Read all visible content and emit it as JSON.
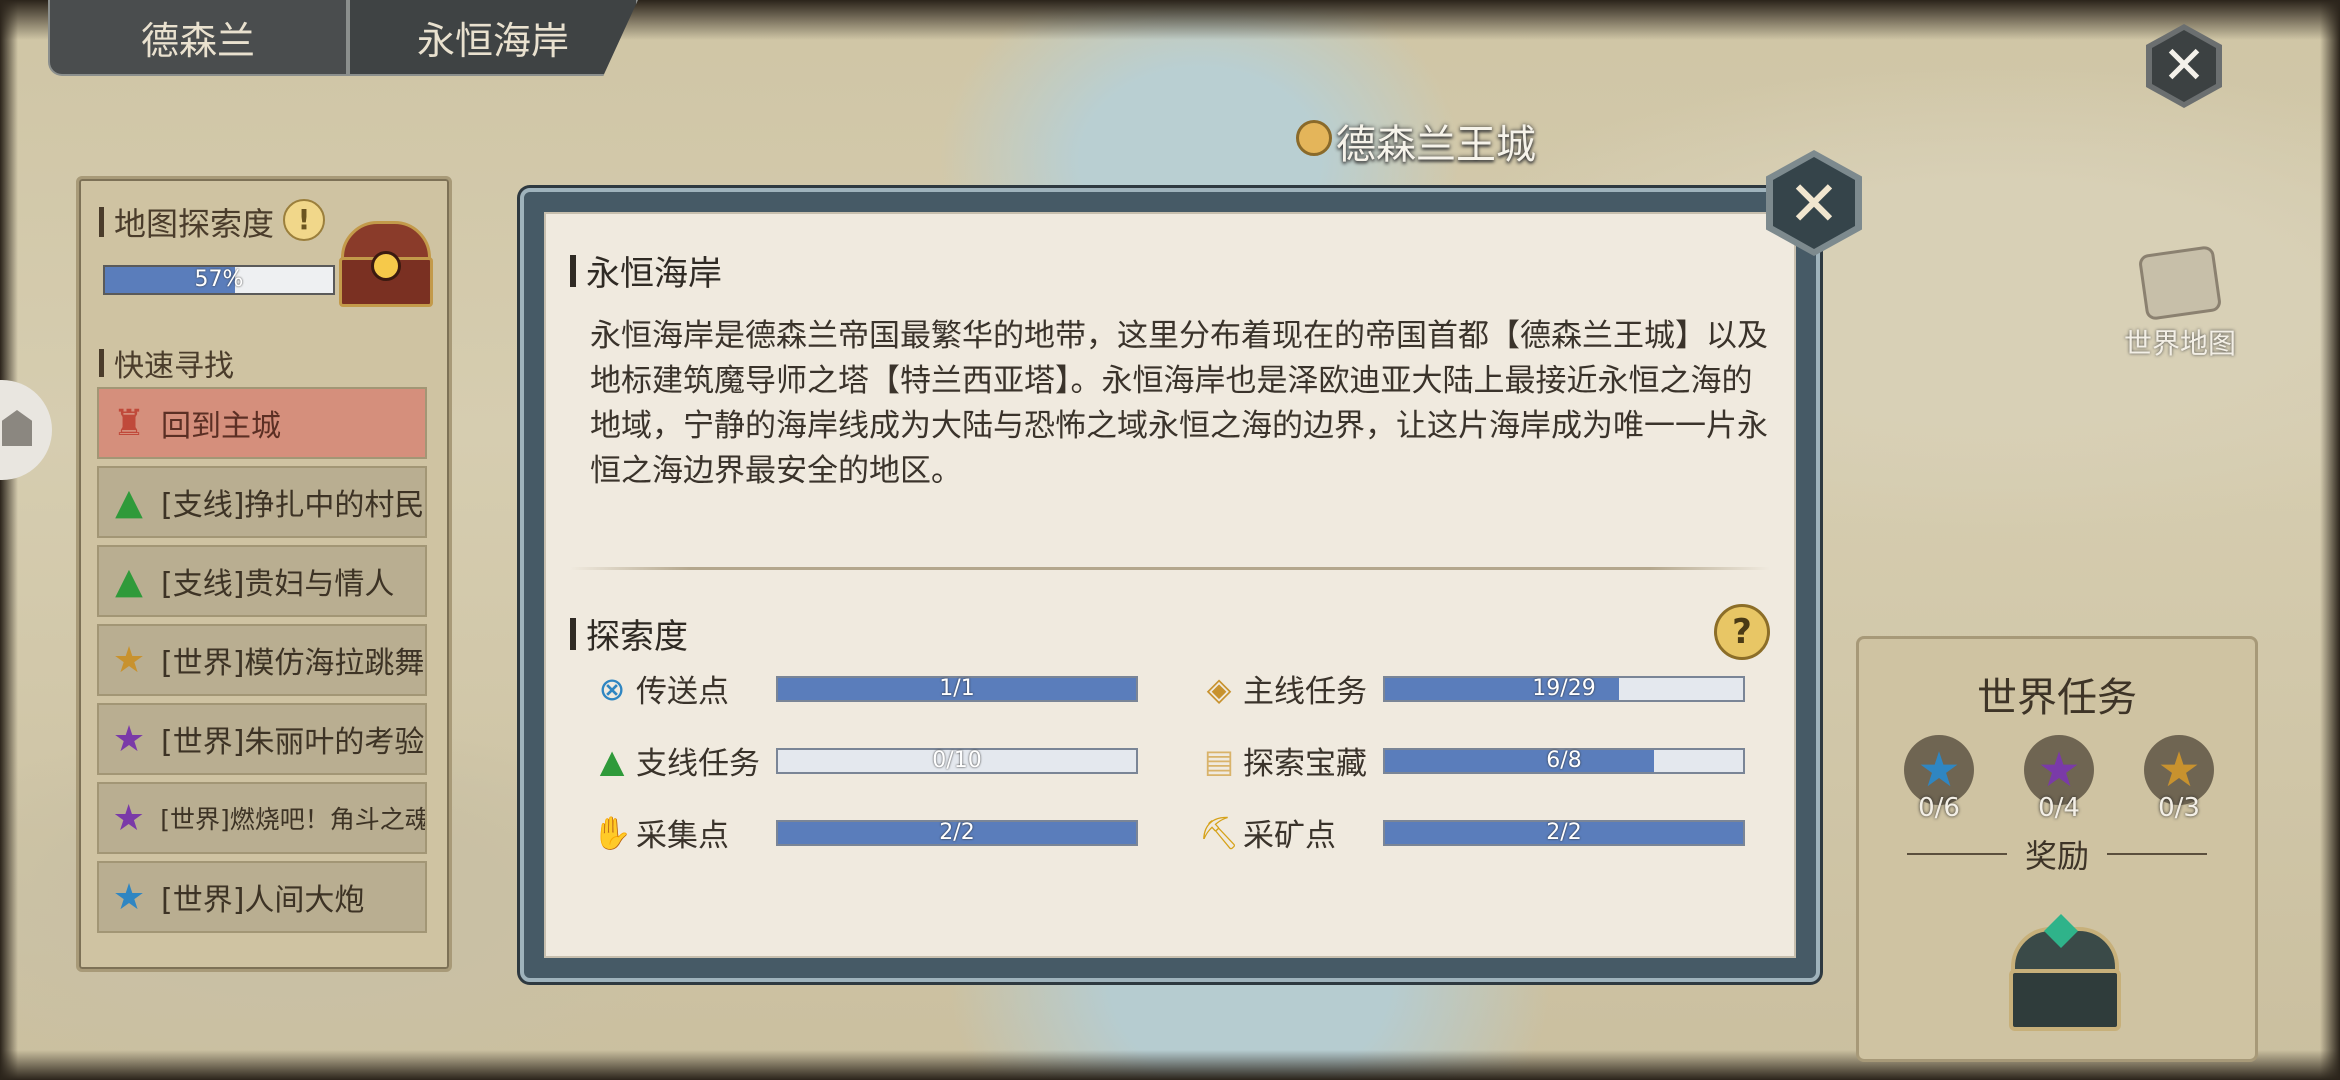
{
  "breadcrumb": {
    "region": "德森兰",
    "area": "永恒海岸"
  },
  "map": {
    "city_label": "德森兰王城",
    "world_map_label": "世界地图"
  },
  "left_panel": {
    "explore_title": "地图探索度",
    "explore_info": "!",
    "explore_progress": 0.57,
    "explore_percent_text": "57%",
    "quick_find_title": "快速寻找",
    "items": [
      {
        "label": "回到主城",
        "icon": "castle-icon",
        "color": "#c0493a"
      },
      {
        "label": "[支线]挣扎中的村民",
        "icon": "side-quest-icon",
        "color": "#2f9a3a"
      },
      {
        "label": "[支线]贵妇与情人",
        "icon": "side-quest-icon",
        "color": "#2f9a3a"
      },
      {
        "label": "[世界]模仿海拉跳舞",
        "icon": "star-icon",
        "color": "#c8922e"
      },
      {
        "label": "[世界]朱丽叶的考验",
        "icon": "star-icon",
        "color": "#7a3aa8"
      },
      {
        "label": "[世界]燃烧吧！角斗之魂",
        "icon": "star-icon",
        "color": "#7a3aa8"
      },
      {
        "label": "[世界]人间大炮",
        "icon": "star-icon",
        "color": "#2f86c2"
      }
    ]
  },
  "modal": {
    "title": "永恒海岸",
    "description": "永恒海岸是德森兰帝国最繁华的地带，这里分布着现在的帝国首都【德森兰王城】以及地标建筑魔导师之塔【特兰西亚塔】。永恒海岸也是泽欧迪亚大陆上最接近永恒之海的地域，宁静的海岸线成为大陆与恐怖之域永恒之海的边界，让这片海岸成为唯一一片永恒之海边界最安全的地区。",
    "explore_title": "探索度",
    "help": "?",
    "close": "✕",
    "stats": [
      {
        "label": "传送点",
        "text": "1/1",
        "progress": 1.0,
        "icon": "teleport-icon"
      },
      {
        "label": "主线任务",
        "text": "19/29",
        "progress": 0.655,
        "icon": "main-quest-icon"
      },
      {
        "label": "支线任务",
        "text": "0/10",
        "progress": 0.0,
        "icon": "side-quest-icon"
      },
      {
        "label": "探索宝藏",
        "text": "6/8",
        "progress": 0.75,
        "icon": "treasure-icon"
      },
      {
        "label": "采集点",
        "text": "2/2",
        "progress": 1.0,
        "icon": "gather-icon"
      },
      {
        "label": "采矿点",
        "text": "2/2",
        "progress": 1.0,
        "icon": "mining-icon"
      }
    ]
  },
  "world_tasks": {
    "title": "世界任务",
    "stars": [
      {
        "count": "0/6",
        "color": "#2f86c2"
      },
      {
        "count": "0/4",
        "color": "#7a3aa8"
      },
      {
        "count": "0/3",
        "color": "#c8922e"
      }
    ],
    "reward_label": "奖励"
  },
  "top_close": "✕"
}
